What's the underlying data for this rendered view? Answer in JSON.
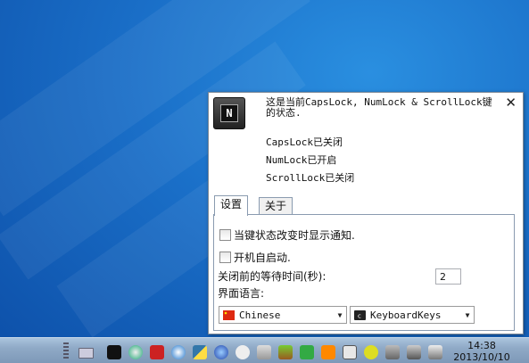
{
  "popup": {
    "app_icon_letter": "N",
    "message": "这是当前CapsLock, NumLock & ScrollLock键的状态.",
    "caps_status": "CapsLock已关闭",
    "num_status": "NumLock已开启",
    "scroll_status": "ScrollLock已关闭",
    "close_symbol": "✕"
  },
  "tabs": [
    {
      "label": "设置",
      "active": true
    },
    {
      "label": "关于",
      "active": false
    }
  ],
  "settings": {
    "notify_label": "当键状态改变时显示通知.",
    "notify_checked": false,
    "autostart_label": "开机自启动.",
    "autostart_checked": false,
    "wait_label": "关闭前的等待时间(秒):",
    "wait_value": "2",
    "language_label": "界面语言:",
    "language_value": "Chinese",
    "language_arrow": "▼",
    "theme_value": "KeyboardKeys",
    "theme_arrow": "▼"
  },
  "taskbar": {
    "time": "14:38",
    "date": "2013/10/10"
  }
}
